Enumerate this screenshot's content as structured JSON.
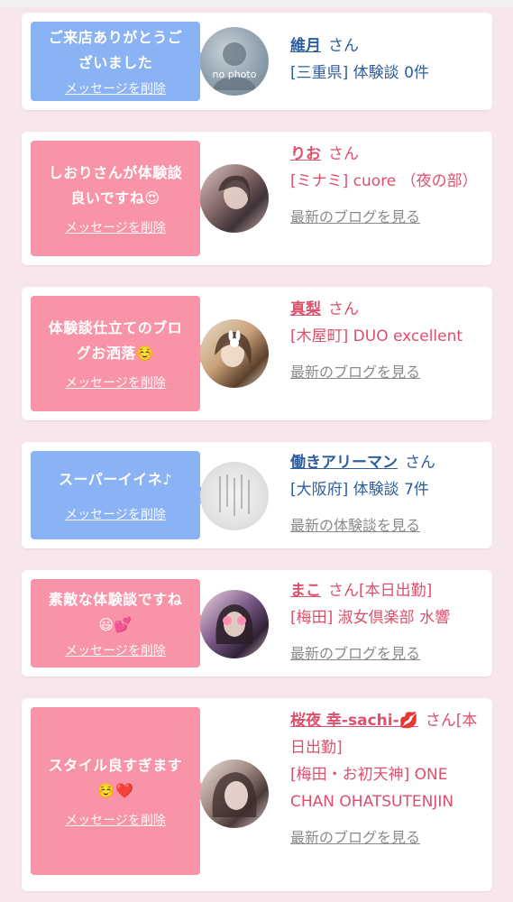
{
  "delete_label": "メッセージを削除",
  "san": "さん",
  "cards": [
    {
      "message": "ご来店ありがとうございました",
      "name": "維月",
      "after_name": "さん",
      "shop": "[三重県] 体験談 0件",
      "link": "",
      "avatar_text": "no photo"
    },
    {
      "message": "しおりさんが体験談良いですね😍",
      "name": "りお",
      "after_name": "さん",
      "shop": "[ミナミ] cuore （夜の部）",
      "link": "最新のブログを見る"
    },
    {
      "message": "体験談仕立てのブログお洒落☺️",
      "name": "真梨",
      "after_name": "さん",
      "shop": "[木屋町] DUO excellent",
      "link": "最新のブログを見る"
    },
    {
      "message": "スーパーイイネ♪",
      "name": "働きアリーマン",
      "after_name": "さん",
      "shop": "[大阪府] 体験談 7件",
      "link": "最新の体験談を見る"
    },
    {
      "message": "素敵な体験談ですね😃💕",
      "name": "まこ",
      "after_name": "さん[本日出勤]",
      "shop": "[梅田] 淑女倶楽部 水響",
      "link": "最新のブログを見る"
    },
    {
      "message": "スタイル良すぎます☺️❤️",
      "name": "桜夜 幸-sachi-💋",
      "after_name": "さん[本日出勤]",
      "shop": "[梅田・お初天神] ONE CHAN OHATSUTENJIN",
      "link": "最新のブログを見る"
    }
  ]
}
